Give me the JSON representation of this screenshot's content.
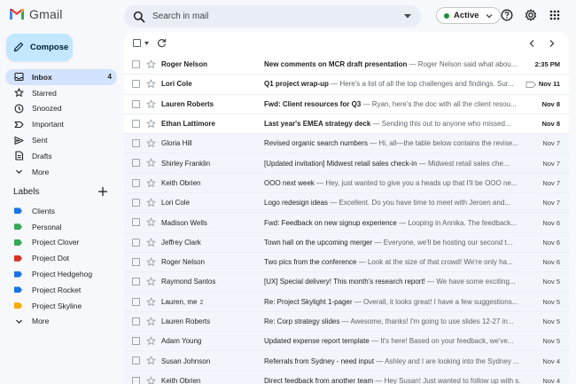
{
  "app": {
    "name": "Gmail"
  },
  "search": {
    "placeholder": "Search in mail"
  },
  "status": {
    "label": "Active"
  },
  "compose": {
    "label": "Compose"
  },
  "nav": [
    {
      "label": "Inbox",
      "count": "4",
      "icon": "inbox-icon",
      "active": true
    },
    {
      "label": "Starred",
      "count": "",
      "icon": "star-icon",
      "active": false
    },
    {
      "label": "Snoozed",
      "count": "",
      "icon": "clock-icon",
      "active": false
    },
    {
      "label": "Important",
      "count": "",
      "icon": "important-icon",
      "active": false
    },
    {
      "label": "Sent",
      "count": "",
      "icon": "send-icon",
      "active": false
    },
    {
      "label": "Drafts",
      "count": "",
      "icon": "draft-icon",
      "active": false
    },
    {
      "label": "More",
      "count": "",
      "icon": "chevron-down-icon",
      "active": false
    }
  ],
  "labels": {
    "heading": "Labels",
    "items": [
      {
        "label": "Clients",
        "color": "#1a73e8"
      },
      {
        "label": "Personal",
        "color": "#34a853"
      },
      {
        "label": "Project Clover",
        "color": "#34a853"
      },
      {
        "label": "Project Dot",
        "color": "#d93025"
      },
      {
        "label": "Project Hedgehog",
        "color": "#1a73e8"
      },
      {
        "label": "Project Rocket",
        "color": "#1a73e8"
      },
      {
        "label": "Project Skyline",
        "color": "#f9ab00"
      }
    ],
    "more": "More"
  },
  "emails": [
    {
      "sender": "Roger Nelson",
      "count": "",
      "subject": "New comments on MCR draft presentation",
      "snippet": " — Roger Nelson said what abou...",
      "date": "2:35 PM",
      "unread": true,
      "label_icon": false
    },
    {
      "sender": "Lori Cole",
      "count": "",
      "subject": "Q1 project wrap-up",
      "snippet": " — Here's a list of all the top challenges and findings. Sur...",
      "date": "Nov 11",
      "unread": true,
      "label_icon": true
    },
    {
      "sender": "Lauren Roberts",
      "count": "",
      "subject": "Fwd: Client resources for Q3",
      "snippet": " — Ryan, here's the doc with all the client resou...",
      "date": "Nov 8",
      "unread": true,
      "label_icon": false
    },
    {
      "sender": "Ethan Lattimore",
      "count": "",
      "subject": "Last year's EMEA strategy deck",
      "snippet": " — Sending this out to anyone who missed...",
      "date": "Nov 8",
      "unread": true,
      "label_icon": false
    },
    {
      "sender": "Gloria Hill",
      "count": "",
      "subject": "Revised organic search numbers",
      "snippet": " — Hi, all—the table below contains the revise...",
      "date": "Nov 7",
      "unread": false,
      "label_icon": false
    },
    {
      "sender": "Shirley Franklin",
      "count": "",
      "subject": "[Updated invitation] Midwest retail sales check-in",
      "snippet": " — Midwest retail sales che...",
      "date": "Nov 7",
      "unread": false,
      "label_icon": false
    },
    {
      "sender": "Keith Obrien",
      "count": "",
      "subject": "OOO next week",
      "snippet": " — Hey, just wanted to give you a heads up that I'll be OOO ne...",
      "date": "Nov 7",
      "unread": false,
      "label_icon": false
    },
    {
      "sender": "Lori Cole",
      "count": "",
      "subject": "Logo redesign ideas",
      "snippet": " — Excellent. Do you have time to meet with Jeroen and...",
      "date": "Nov 7",
      "unread": false,
      "label_icon": false
    },
    {
      "sender": "Madison Wells",
      "count": "",
      "subject": "Fwd: Feedback on new signup experience",
      "snippet": " — Looping in Annika. The feedback...",
      "date": "Nov 6",
      "unread": false,
      "label_icon": false
    },
    {
      "sender": "Jeffrey Clark",
      "count": "",
      "subject": "Town hall on the upcoming merger",
      "snippet": " — Everyone, we'll be hosting our second t...",
      "date": "Nov 6",
      "unread": false,
      "label_icon": false
    },
    {
      "sender": "Roger Nelson",
      "count": "",
      "subject": "Two pics from the conference",
      "snippet": " — Look at the size of that crowd! We're only ha...",
      "date": "Nov 6",
      "unread": false,
      "label_icon": false
    },
    {
      "sender": "Raymond Santos",
      "count": "",
      "subject": "[UX] Special delivery! This month's research report!",
      "snippet": " — We have some exciting...",
      "date": "Nov 5",
      "unread": false,
      "label_icon": false
    },
    {
      "sender": "Lauren, me",
      "count": "2",
      "subject": "Re: Project Skylight 1-pager",
      "snippet": " — Overall, it looks great! I have a few suggestions...",
      "date": "Nov 5",
      "unread": false,
      "label_icon": false
    },
    {
      "sender": "Lauren Roberts",
      "count": "",
      "subject": "Re: Corp strategy slides",
      "snippet": " — Awesome, thanks! I'm going to use slides 12-27 in...",
      "date": "Nov 5",
      "unread": false,
      "label_icon": false
    },
    {
      "sender": "Adam Young",
      "count": "",
      "subject": "Updated expense report template",
      "snippet": " — It's here! Based on your feedback, we've...",
      "date": "Nov 5",
      "unread": false,
      "label_icon": false
    },
    {
      "sender": "Susan Johnson",
      "count": "",
      "subject": "Referrals from Sydney - need input",
      "snippet": " — Ashley and I are looking into the Sydney ...",
      "date": "Nov 4",
      "unread": false,
      "label_icon": false
    },
    {
      "sender": "Keith Obrien",
      "count": "",
      "subject": "Direct feedback from another team",
      "snippet": " — Hey Susan! Just wanted to follow up with s...",
      "date": "Nov 4",
      "unread": false,
      "label_icon": false
    }
  ]
}
